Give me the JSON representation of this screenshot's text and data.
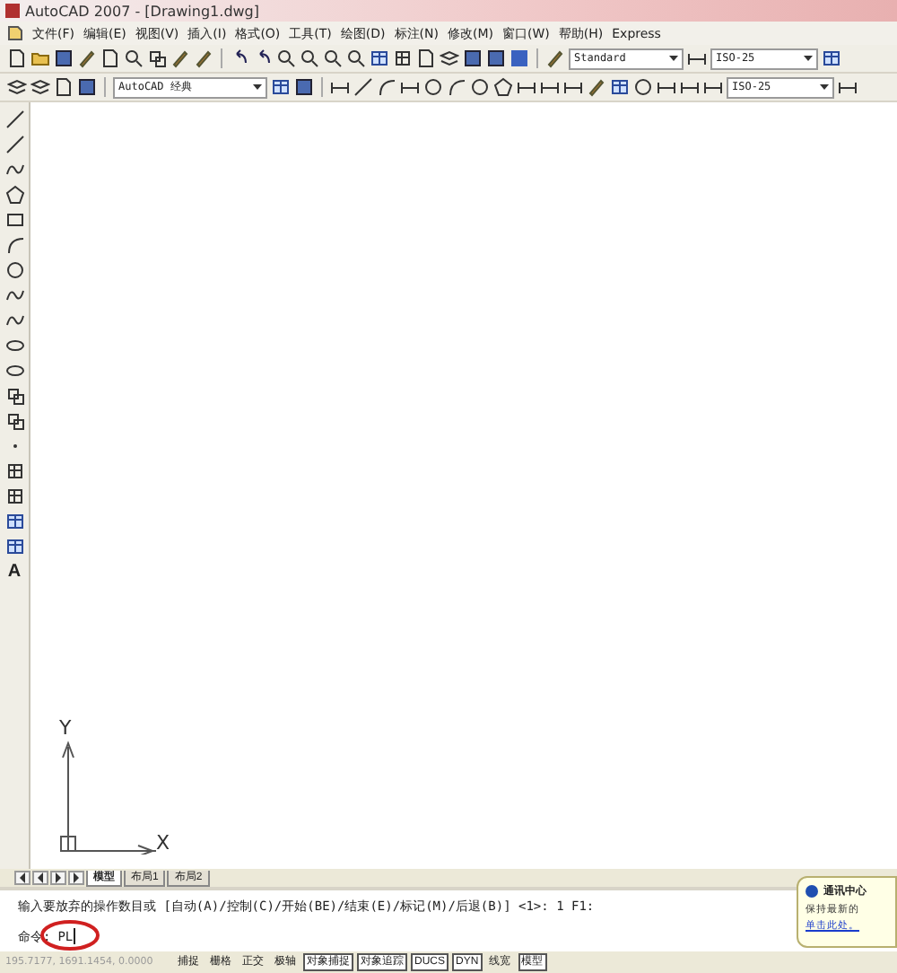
{
  "window": {
    "title": "AutoCAD 2007 - [Drawing1.dwg]"
  },
  "menu": [
    "文件(F)",
    "编辑(E)",
    "视图(V)",
    "插入(I)",
    "格式(O)",
    "工具(T)",
    "绘图(D)",
    "标注(N)",
    "修改(M)",
    "窗口(W)",
    "帮助(H)",
    "Express"
  ],
  "toolbar1_dropdowns": [
    "Standard",
    "ISO-25"
  ],
  "toolbar2_dropdowns": [
    "AutoCAD 经典",
    "ISO-25"
  ],
  "draw_toolbar": {
    "text_tool": "A"
  },
  "ucs": {
    "y_label": "Y",
    "x_label": "X"
  },
  "layout_tabs": [
    {
      "label": "模型",
      "selected": true
    },
    {
      "label": "布局1",
      "selected": false
    },
    {
      "label": "布局2",
      "selected": false
    }
  ],
  "command": {
    "history": "输入要放弃的操作数目或 [自动(A)/控制(C)/开始(BE)/结束(E)/标记(M)/后退(B)] <1>: 1 F1:",
    "prompt": "命令:",
    "input": "PL"
  },
  "notification": {
    "title": "通讯中心",
    "text": "保持最新的",
    "link": "单击此处。"
  },
  "status_bar": {
    "coordinates": "195.7177, 1691.1454, 0.0000",
    "toggles": [
      {
        "label": "捕捉",
        "on": false
      },
      {
        "label": "栅格",
        "on": false
      },
      {
        "label": "正交",
        "on": false
      },
      {
        "label": "极轴",
        "on": false
      },
      {
        "label": "对象捕捉",
        "on": true
      },
      {
        "label": "对象追踪",
        "on": true
      },
      {
        "label": "DUCS",
        "on": true
      },
      {
        "label": "DYN",
        "on": true
      },
      {
        "label": "线宽",
        "on": false
      },
      {
        "label": "模型",
        "on": true
      }
    ]
  }
}
